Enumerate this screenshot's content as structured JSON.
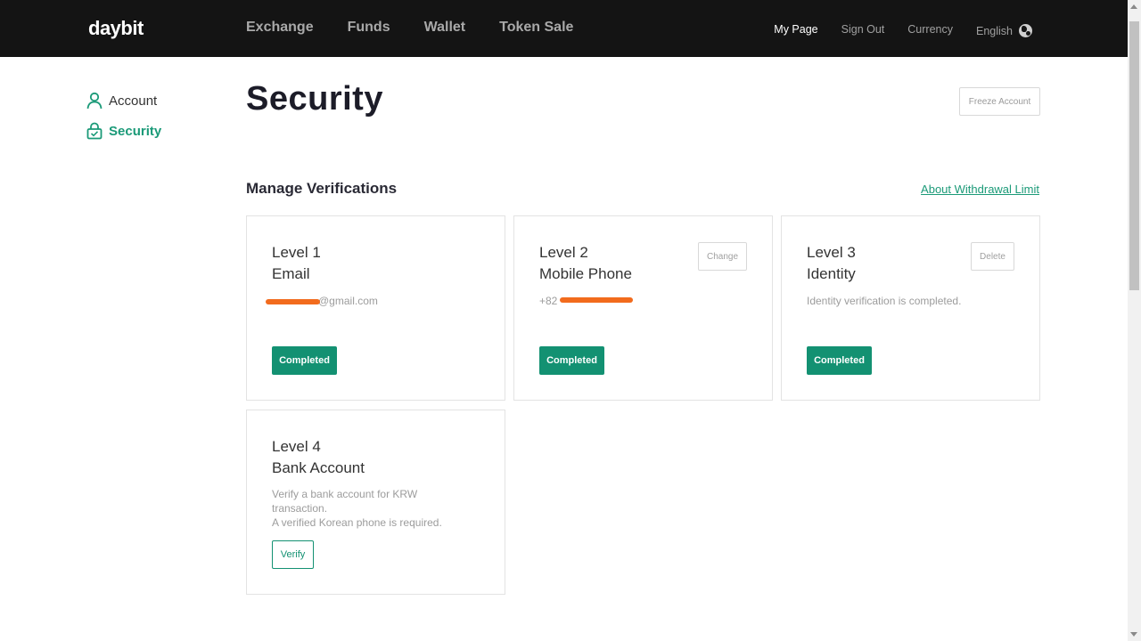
{
  "header": {
    "logo": "daybit",
    "nav": [
      "Exchange",
      "Funds",
      "Wallet",
      "Token Sale"
    ],
    "right_nav": {
      "my_page": "My Page",
      "sign_out": "Sign Out",
      "currency": "Currency",
      "language": "English"
    }
  },
  "sidebar": {
    "items": [
      {
        "label": "Account",
        "icon": "user-icon",
        "active": false
      },
      {
        "label": "Security",
        "icon": "lock-icon",
        "active": true
      }
    ]
  },
  "main": {
    "title": "Security",
    "freeze_button": "Freeze Account",
    "section_title": "Manage Verifications",
    "about_link": "About Withdrawal Limit",
    "cards": [
      {
        "level": "Level 1",
        "name": "Email",
        "detail": "@gmail.com",
        "status": "Completed"
      },
      {
        "level": "Level 2",
        "name": "Mobile Phone",
        "detail": "+82",
        "action": "Change",
        "status": "Completed"
      },
      {
        "level": "Level 3",
        "name": "Identity",
        "detail": "Identity verification is completed.",
        "action": "Delete",
        "status": "Completed"
      },
      {
        "level": "Level 4",
        "name": "Bank Account",
        "detail_line1": "Verify a bank account for KRW transaction.",
        "detail_line2": "A verified Korean phone is required.",
        "action": "Verify"
      }
    ]
  },
  "colors": {
    "accent": "#139172",
    "topbar": "#141414",
    "redaction": "#f26b1d"
  }
}
